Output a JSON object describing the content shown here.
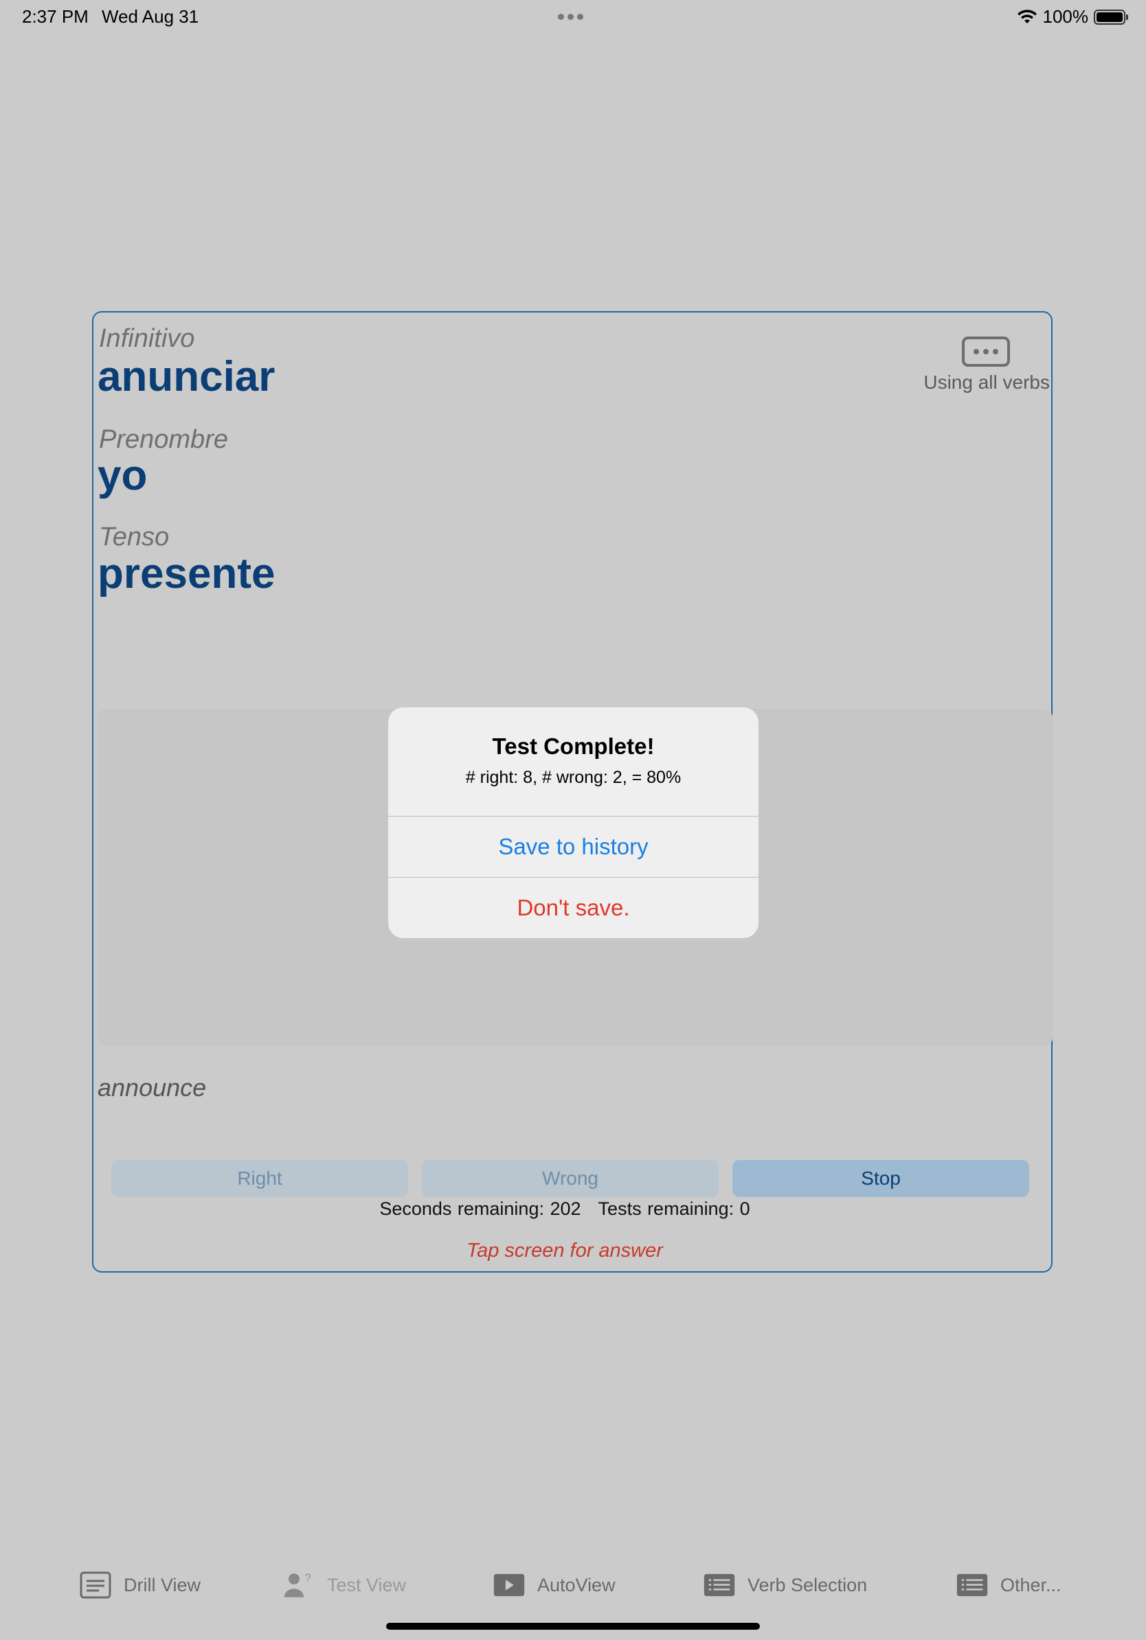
{
  "status_bar": {
    "time": "2:37 PM",
    "date": "Wed Aug 31",
    "battery_percent": "100%",
    "battery_level": 1.0
  },
  "card": {
    "infinitive_label": "Infinitivo",
    "infinitive_value": "anunciar",
    "pronoun_label": "Prenombre",
    "pronoun_value": "yo",
    "tense_label": "Tenso",
    "tense_value": "presente",
    "verb_filter_label": "Using all verbs",
    "translation": "announce",
    "buttons": {
      "right": "Right",
      "wrong": "Wrong",
      "stop": "Stop"
    },
    "seconds_remaining": "Seconds remaining: 202",
    "tests_remaining": "Tests remaining: 0",
    "tap_hint": "Tap screen for answer"
  },
  "alert": {
    "title": "Test Complete!",
    "message": "# right: 8, # wrong: 2, = 80%",
    "save_action": "Save to history",
    "dont_save_action": "Don't save."
  },
  "tab_bar": {
    "items": [
      {
        "label": "Drill View",
        "icon": "drill-view-icon"
      },
      {
        "label": "Test View",
        "icon": "test-view-icon"
      },
      {
        "label": "AutoView",
        "icon": "play-icon"
      },
      {
        "label": "Verb Selection",
        "icon": "list-icon"
      },
      {
        "label": "Other...",
        "icon": "list-icon"
      }
    ]
  },
  "colors": {
    "accent_blue": "#0b3e74",
    "card_border": "#1e6aa8",
    "action_blue": "#1a7fe0",
    "destructive_red": "#e0382b",
    "hint_red": "#c63a2c"
  }
}
